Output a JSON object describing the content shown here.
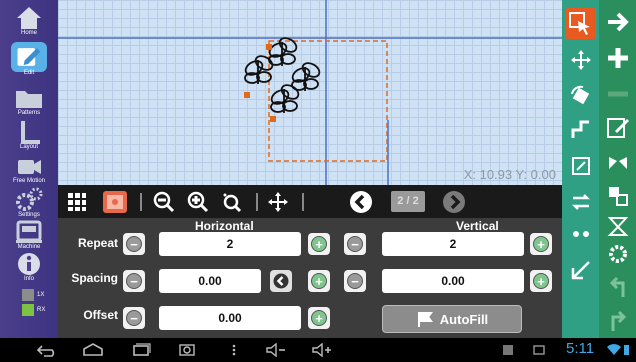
{
  "sidebar": {
    "items": [
      {
        "label": "Home",
        "icon": "home-icon"
      },
      {
        "label": "Edit",
        "icon": "edit-icon"
      },
      {
        "label": "Patterns",
        "icon": "folder-icon"
      },
      {
        "label": "Layout",
        "icon": "layout-icon"
      },
      {
        "label": "Free Motion",
        "icon": "camera-icon"
      },
      {
        "label": "Settings",
        "icon": "gears-icon"
      },
      {
        "label": "Machine",
        "icon": "machine-icon"
      },
      {
        "label": "Info",
        "icon": "info-icon"
      }
    ],
    "formats": [
      {
        "label": "1X",
        "color": "#8c8c8c"
      },
      {
        "label": "RX",
        "color": "#7dc242"
      }
    ]
  },
  "canvas": {
    "coord_text": "X: 10.93 Y: 0.00"
  },
  "toolbar": {
    "page_indicator": "2 / 2"
  },
  "params": {
    "horizontal_header": "Horizontal",
    "vertical_header": "Vertical",
    "repeat_label": "Repeat",
    "spacing_label": "Spacing",
    "offset_label": "Offset",
    "h_repeat": "2",
    "v_repeat": "2",
    "h_spacing": "0.00",
    "v_spacing": "0.00",
    "h_offset": "0.00",
    "autofill_label": "AutoFill"
  },
  "statusbar": {
    "time": "5:11"
  },
  "colors": {
    "sidebar": "#4b3f8c",
    "tool_column": "#2fa083",
    "action_column": "#2a8f5c",
    "active_tool": "#e85a1f",
    "canvas": "#cfe1f4",
    "clock": "#3fa9e8"
  }
}
